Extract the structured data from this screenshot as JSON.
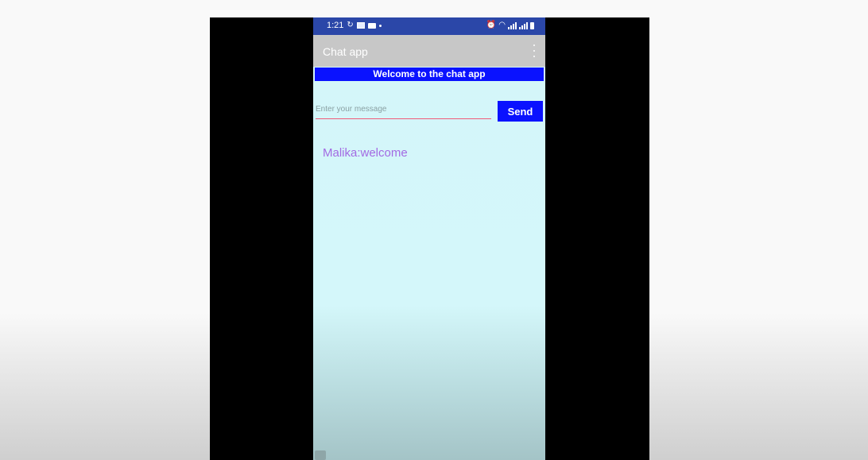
{
  "status_bar": {
    "time": "1:21",
    "left_icons": [
      "sync-icon",
      "image-notification-icon",
      "message-notification-icon",
      "dot-icon"
    ],
    "right_icons": [
      "alarm-icon",
      "wifi-icon",
      "signal-icon",
      "battery-icon"
    ]
  },
  "app_bar": {
    "title": "Chat app",
    "menu_icon": "overflow-menu-icon"
  },
  "banner": {
    "text": "Welcome to the chat app",
    "color": "#0a12ff"
  },
  "composer": {
    "placeholder": "Enter your message",
    "value": "",
    "send_label": "Send",
    "underline_color": "#f05a78"
  },
  "messages": [
    {
      "text": "Malika:welcome",
      "color": "#a36ae3"
    }
  ]
}
